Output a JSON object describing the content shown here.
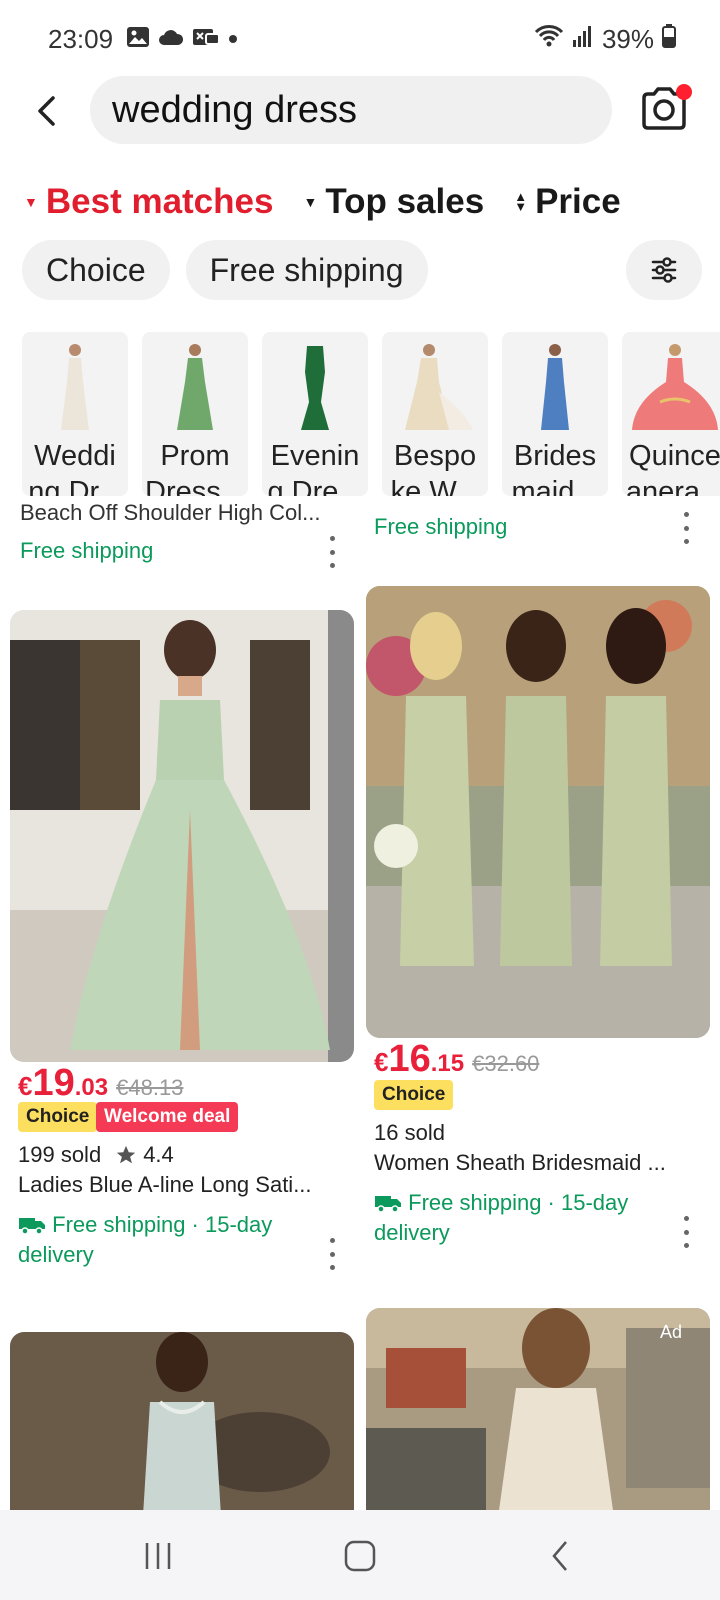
{
  "status": {
    "time": "23:09",
    "battery": "39%"
  },
  "search": {
    "query": "wedding dress"
  },
  "sort": [
    {
      "label": "Best matches",
      "active": true
    },
    {
      "label": "Top sales",
      "active": false
    },
    {
      "label": "Price",
      "active": false
    }
  ],
  "chips": [
    "Choice",
    "Free shipping"
  ],
  "categories": [
    {
      "line1": "Weddi",
      "line2": "ng Dr..."
    },
    {
      "line1": "Prom",
      "line2": "Dress..."
    },
    {
      "line1": "Evenin",
      "line2": "g Dre..."
    },
    {
      "line1": "Bespo",
      "line2": "ke W..."
    },
    {
      "line1": "Brides",
      "line2": "maid..."
    },
    {
      "line1": "Quince",
      "line2": "anera..."
    }
  ],
  "partial": {
    "left_title": "Beach Off Shoulder High Col...",
    "left_shipping": "Free shipping",
    "right_shipping": "Free shipping"
  },
  "products": [
    {
      "currency": "€",
      "price_int": "19",
      "price_dec": ".03",
      "old_price": "€48.13",
      "badges": [
        "Choice",
        "Welcome deal"
      ],
      "sold": "199 sold",
      "rating": "4.4",
      "title": "Ladies Blue A-line Long Sati...",
      "shipping_line1": "Free shipping · 15-day",
      "shipping_line2": "delivery"
    },
    {
      "currency": "€",
      "price_int": "16",
      "price_dec": ".15",
      "old_price": "€32.60",
      "badges": [
        "Choice"
      ],
      "sold": "16 sold",
      "title": "Women Sheath Bridesmaid ...",
      "shipping_line1": "Free shipping · 15-day",
      "shipping_line2": "delivery"
    }
  ],
  "ad_label": "Ad",
  "colors": {
    "accent_red": "#e11e2d",
    "price_red": "#e8203a",
    "shipping_green": "#0b9a5b",
    "choice_yellow": "#fddf60",
    "welcome_pink": "#f43a55"
  }
}
